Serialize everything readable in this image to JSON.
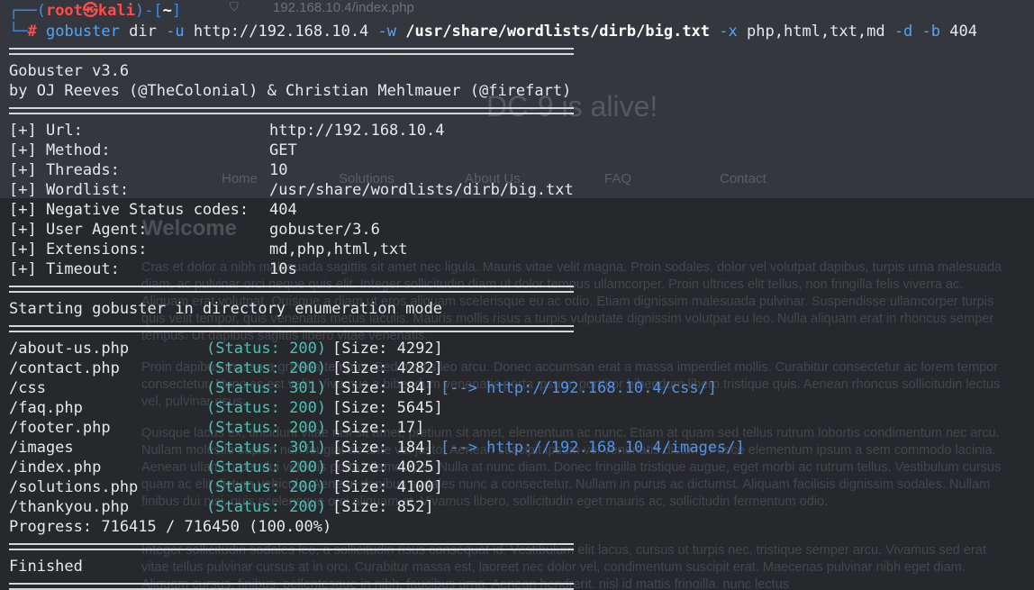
{
  "background_page": {
    "address_bar": "192.168.10.4/index.php",
    "hero_text": "DC-9 is alive!",
    "nav": [
      "Home",
      "Solutions",
      "About Us",
      "FAQ",
      "Contact"
    ],
    "heading": "Welcome",
    "paragraphs": [
      "Cras et dolor a nibh malesuada sagittis sit amet nec ligula. Mauris vitae velit magna. Proin sodales, dolor vel volutpat dapibus, turpis urna malesuada diam, ac pulvinar orci neque quis elit. Integer sollicitudin diam ut dolor tempus ullamcorper. Proin ultrices elit tellus, non fringilla felis viverra ac. Aliquam erat volutpat. Quisque a diam ut eros aliquam scelerisque eu ac odio. Etiam dignissim malesuada pulvinar. Suspendisse ullamcorper turpis quis velit tempor, quis venenatis metus iaculis. Mauris mollis risus a turpis vulputate dignissim volutpat eu leo. Nulla aliquam erat in rhoncus semper tempus. Ut dapibus sagittis libero vitae venenatis.",
      "Proin dapibus massa a gravida tempus. Sed mattis leo arcu. Donec accumsan erat a massa imperdiet mollis. Curabitur consectetur ac lorem tempor consectetur. Nunc ac est velit. Vivamus a bibendum venenatis porta ipsum, porttitor bibendum libero tristique quis. Aenean rhoncus sollicitudin lectus vel, pulvinar risus.",
      "Quisque lacus ex, tincidunt vitae nisl sit amet, pretium sit amet, elementum ac nunc. Etiam at quam sed tellus rutrum lobortis condimentum nec arcu. Nullam molestie sapien non feugiat ac ante vel justo. Aenean suscipit ipsum vel venenatis dictum. Fusce elementum ipsum a sem commodo lacinia. Aenean ullamcorper dui vel felis porta ullamcorper. Nulla at nunc diam. Donec fringilla tristique augue, eget morbi ac rutrum tellus. Vestibulum cursus quam ac elit dictum vehicula. Aenean dapibus sodales nunc a consectetur. Nullam in purus ac dictumst. Aliquam facilisis dignissim sodales. Nullam finibus dui nisi, quis scelerisque orci aliquam at. Vivamus libero, sollicitudin eget mauris ac, sollicitudin fermentum odio.",
      "Integer sollicitudin sodales leo, a sollicitudin risus consequat id. Vestibulum elit lacus, cursus ut turpis nec, tristique semper arcu. Vivamus sed erat vitae tellus pulvinar cursus at in orci. Curabitur massa est, laoreet nec dolor vel, condimentum suscipit erat. Maecenas pulvinar nibh eget diam. Aliquam cursus, finibus, pellentesque in nibh, faucibus urna. Aenean hendrerit, nisl id mattis fringilla, nunc lectus"
    ]
  },
  "prompt": {
    "open": "┌──(",
    "user": "root㉿kali",
    "mid": ")-[",
    "path": "~",
    "close": "]",
    "corner": "└─",
    "hash": "#"
  },
  "command": {
    "program": "gobuster",
    "sub": "dir",
    "flag_u": "-u",
    "url": "http://192.168.10.4",
    "flag_w": "-w",
    "wordlist": "/usr/share/wordlists/dirb/big.txt",
    "flag_x": "-x",
    "ext": "php,html,txt,md",
    "flag_d": "-d",
    "flag_b": "-b",
    "code": "404"
  },
  "banner": {
    "version": "Gobuster v3.6",
    "authors": "by OJ Reeves (@TheColonial) & Christian Mehlmauer (@firefart)"
  },
  "config": [
    {
      "label": "[+] Url:",
      "value": "http://192.168.10.4"
    },
    {
      "label": "[+] Method:",
      "value": "GET"
    },
    {
      "label": "[+] Threads:",
      "value": "10"
    },
    {
      "label": "[+] Wordlist:",
      "value": "/usr/share/wordlists/dirb/big.txt"
    },
    {
      "label": "[+] Negative Status codes:",
      "value": "404"
    },
    {
      "label": "[+] User Agent:",
      "value": "gobuster/3.6"
    },
    {
      "label": "[+] Extensions:",
      "value": "md,php,html,txt"
    },
    {
      "label": "[+] Timeout:",
      "value": "10s"
    }
  ],
  "start_msg": "Starting gobuster in directory enumeration mode",
  "results": [
    {
      "path": "/about-us.php",
      "status": "(Status: 200)",
      "size": "[Size: 4292]",
      "redirect": ""
    },
    {
      "path": "/contact.php",
      "status": "(Status: 200)",
      "size": "[Size: 4282]",
      "redirect": ""
    },
    {
      "path": "/css",
      "status": "(Status: 301)",
      "size": "[Size: 184]",
      "redirect": "[--> http://192.168.10.4/css/]"
    },
    {
      "path": "/faq.php",
      "status": "(Status: 200)",
      "size": "[Size: 5645]",
      "redirect": ""
    },
    {
      "path": "/footer.php",
      "status": "(Status: 200)",
      "size": "[Size: 17]",
      "redirect": ""
    },
    {
      "path": "/images",
      "status": "(Status: 301)",
      "size": "[Size: 184]",
      "redirect": "[--> http://192.168.10.4/images/]"
    },
    {
      "path": "/index.php",
      "status": "(Status: 200)",
      "size": "[Size: 4025]",
      "redirect": ""
    },
    {
      "path": "/solutions.php",
      "status": "(Status: 200)",
      "size": "[Size: 4100]",
      "redirect": ""
    },
    {
      "path": "/thankyou.php",
      "status": "(Status: 200)",
      "size": "[Size: 852]",
      "redirect": ""
    }
  ],
  "progress": "Progress: 716415 / 716450 (100.00%)",
  "finished": "Finished",
  "colors": {
    "prompt_blue": "#3b8eea",
    "prompt_user": "#ff4b4b",
    "status_teal": "#49c1b5",
    "redirect_blue": "#4f94ef",
    "text": "#e8e8ea"
  }
}
